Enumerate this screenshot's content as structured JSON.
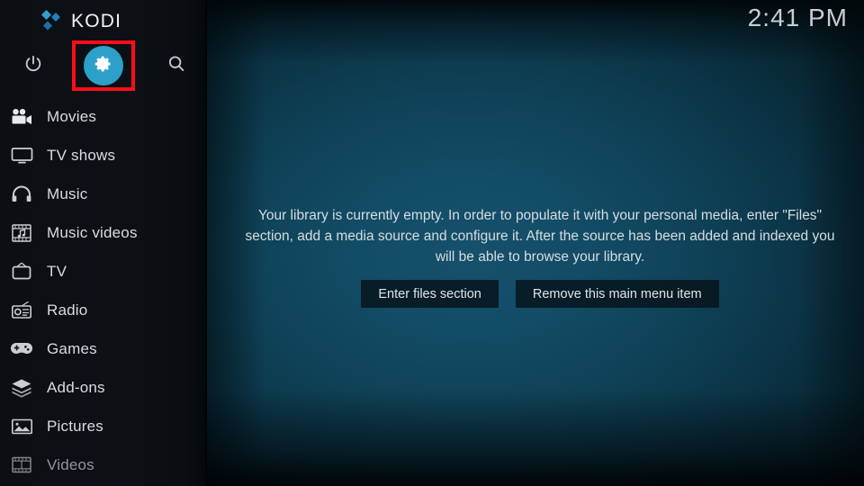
{
  "app": {
    "brand": "KODI",
    "logo_icon": "kodi-logo-icon",
    "accent_color": "#2ca0c9",
    "highlight_color": "#fb0d1b"
  },
  "header": {
    "clock": "2:41 PM"
  },
  "sidebar": {
    "top_actions": [
      {
        "name": "power-button",
        "icon": "power-icon",
        "label": "Power"
      },
      {
        "name": "settings-button",
        "icon": "gear-icon",
        "label": "Settings",
        "selected": true
      },
      {
        "name": "search-button",
        "icon": "search-icon",
        "label": "Search"
      }
    ],
    "items": [
      {
        "label": "Movies",
        "icon": "movie-camera-icon",
        "dim": false
      },
      {
        "label": "TV shows",
        "icon": "television-icon",
        "dim": false
      },
      {
        "label": "Music",
        "icon": "headphones-icon",
        "dim": false
      },
      {
        "label": "Music videos",
        "icon": "music-video-icon",
        "dim": false
      },
      {
        "label": "TV",
        "icon": "tv-antenna-icon",
        "dim": false
      },
      {
        "label": "Radio",
        "icon": "radio-icon",
        "dim": false
      },
      {
        "label": "Games",
        "icon": "gamepad-icon",
        "dim": false
      },
      {
        "label": "Add-ons",
        "icon": "addon-box-icon",
        "dim": false
      },
      {
        "label": "Pictures",
        "icon": "pictures-icon",
        "dim": false
      },
      {
        "label": "Videos",
        "icon": "film-strip-icon",
        "dim": true
      }
    ]
  },
  "main": {
    "empty_message": "Your library is currently empty. In order to populate it with your personal media, enter \"Files\" section, add a media source and configure it. After the source has been added and indexed you will be able to browse your library.",
    "buttons": [
      {
        "label": "Enter files section",
        "name": "enter-files-section-button"
      },
      {
        "label": "Remove this main menu item",
        "name": "remove-main-menu-item-button"
      }
    ]
  }
}
